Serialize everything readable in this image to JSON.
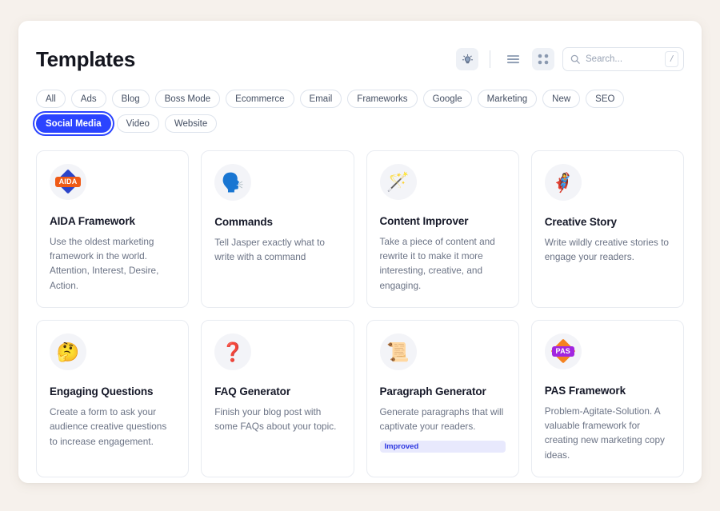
{
  "header": {
    "title": "Templates",
    "tools": [
      {
        "name": "ideas-lightbulb-button",
        "icon": "lightbulb-icon",
        "active": true
      },
      {
        "name": "list-view-button",
        "icon": "list-view-icon",
        "active": false
      },
      {
        "name": "grid-view-button",
        "icon": "grid-view-icon",
        "active": true
      }
    ],
    "search": {
      "placeholder": "Search...",
      "value": "",
      "shortcut": "/"
    }
  },
  "filters": {
    "items": [
      {
        "label": "All",
        "active": false
      },
      {
        "label": "Ads",
        "active": false
      },
      {
        "label": "Blog",
        "active": false
      },
      {
        "label": "Boss Mode",
        "active": false
      },
      {
        "label": "Ecommerce",
        "active": false
      },
      {
        "label": "Email",
        "active": false
      },
      {
        "label": "Frameworks",
        "active": false
      },
      {
        "label": "Google",
        "active": false
      },
      {
        "label": "Marketing",
        "active": false
      },
      {
        "label": "New",
        "active": false
      },
      {
        "label": "SEO",
        "active": false
      },
      {
        "label": "Social Media",
        "active": true
      },
      {
        "label": "Video",
        "active": false
      },
      {
        "label": "Website",
        "active": false
      }
    ]
  },
  "cards": [
    {
      "icon_kind": "mark-aida",
      "icon_name": "aida-framework-icon",
      "icon_text": "AIDA",
      "title": "AIDA Framework",
      "description": "Use the oldest marketing framework in the world. Attention, Interest, Desire, Action.",
      "badge": ""
    },
    {
      "icon_kind": "emoji",
      "icon_name": "speaking-head-icon",
      "icon_text": "🗣️",
      "title": "Commands",
      "description": "Tell Jasper exactly what to write with a command",
      "badge": ""
    },
    {
      "icon_kind": "emoji",
      "icon_name": "magic-wand-icon",
      "icon_text": "🪄",
      "title": "Content Improver",
      "description": "Take a piece of content and rewrite it to make it more interesting, creative, and engaging.",
      "badge": ""
    },
    {
      "icon_kind": "emoji",
      "icon_name": "superhero-icon",
      "icon_text": "🦸‍♀️",
      "title": "Creative Story",
      "description": "Write wildly creative stories to engage your readers.",
      "badge": ""
    },
    {
      "icon_kind": "emoji",
      "icon_name": "thinking-face-icon",
      "icon_text": "🤔",
      "title": "Engaging Questions",
      "description": "Create a form to ask your audience creative questions to increase engagement.",
      "badge": ""
    },
    {
      "icon_kind": "emoji",
      "icon_name": "question-mark-icon",
      "icon_text": "❓",
      "title": "FAQ Generator",
      "description": "Finish your blog post with some FAQs about your topic.",
      "badge": ""
    },
    {
      "icon_kind": "emoji",
      "icon_name": "scroll-icon",
      "icon_text": "📜",
      "title": "Paragraph Generator",
      "description": "Generate paragraphs that will captivate your readers.",
      "badge": "Improved"
    },
    {
      "icon_kind": "mark-pas",
      "icon_name": "pas-framework-icon",
      "icon_text": "PAS",
      "title": "PAS Framework",
      "description": "Problem-Agitate-Solution. A valuable framework for creating new marketing copy ideas.",
      "badge": ""
    }
  ],
  "colors": {
    "accent": "#2b44ff",
    "page_background": "#f6f1ec",
    "panel": "#ffffff",
    "badge_text": "#2b35e0",
    "badge_background": "#e8e9fd",
    "card_border": "#e8ebf1",
    "title_text": "#151828",
    "body_text": "#6b7385"
  }
}
